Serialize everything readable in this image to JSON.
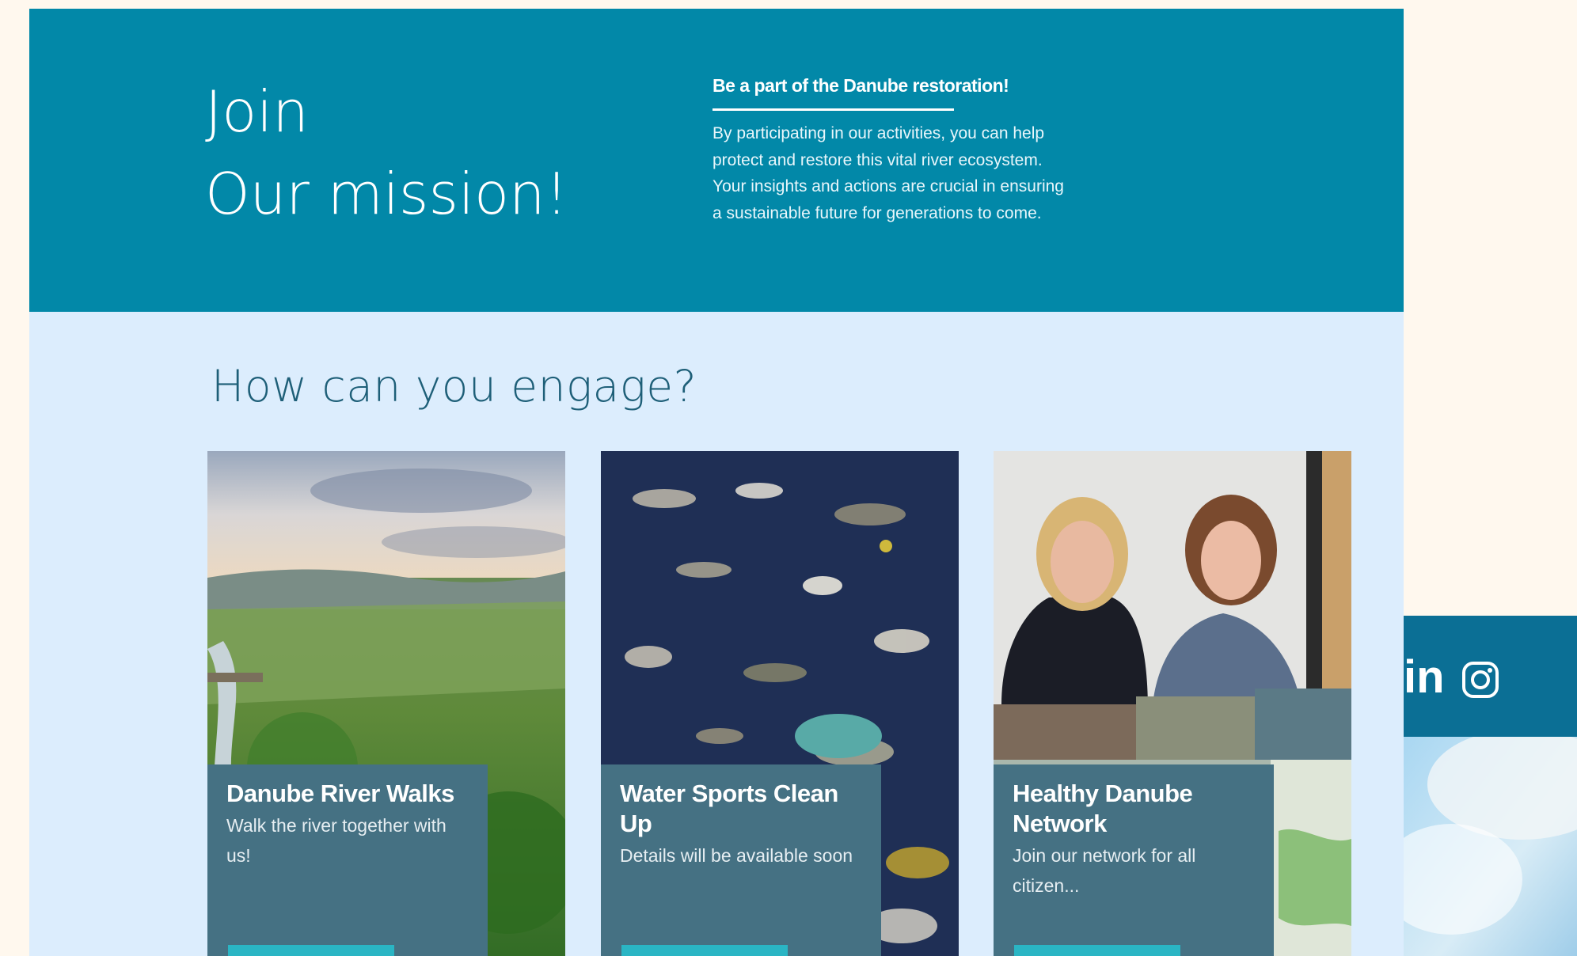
{
  "hero": {
    "title_line1": "Join",
    "title_line2": "Our mission!",
    "subheading": "Be a part of the Danube restoration!",
    "body": "By participating in our activities, you can help protect and restore this vital river ecosystem. Your insights and actions are crucial in ensuring a sustainable future for generations to come."
  },
  "engage": {
    "title": "How can you engage?",
    "cards": [
      {
        "title": "Danube River Walks",
        "description": "Walk the river together with us!"
      },
      {
        "title": "Water Sports Clean Up",
        "description": "Details will be available soon"
      },
      {
        "title": "Healthy Danube Network",
        "description": "Join our network for all citizen..."
      }
    ]
  },
  "social": {
    "linkedin_label": "in",
    "icons": [
      "linkedin-icon",
      "instagram-icon"
    ]
  },
  "colors": {
    "hero_bg": "#0288a8",
    "section_bg": "#dcedfd",
    "card_panel": "#457183",
    "button": "#2ab5c4",
    "social_bar": "#0b6f95",
    "page_bg": "#fff8ee"
  }
}
